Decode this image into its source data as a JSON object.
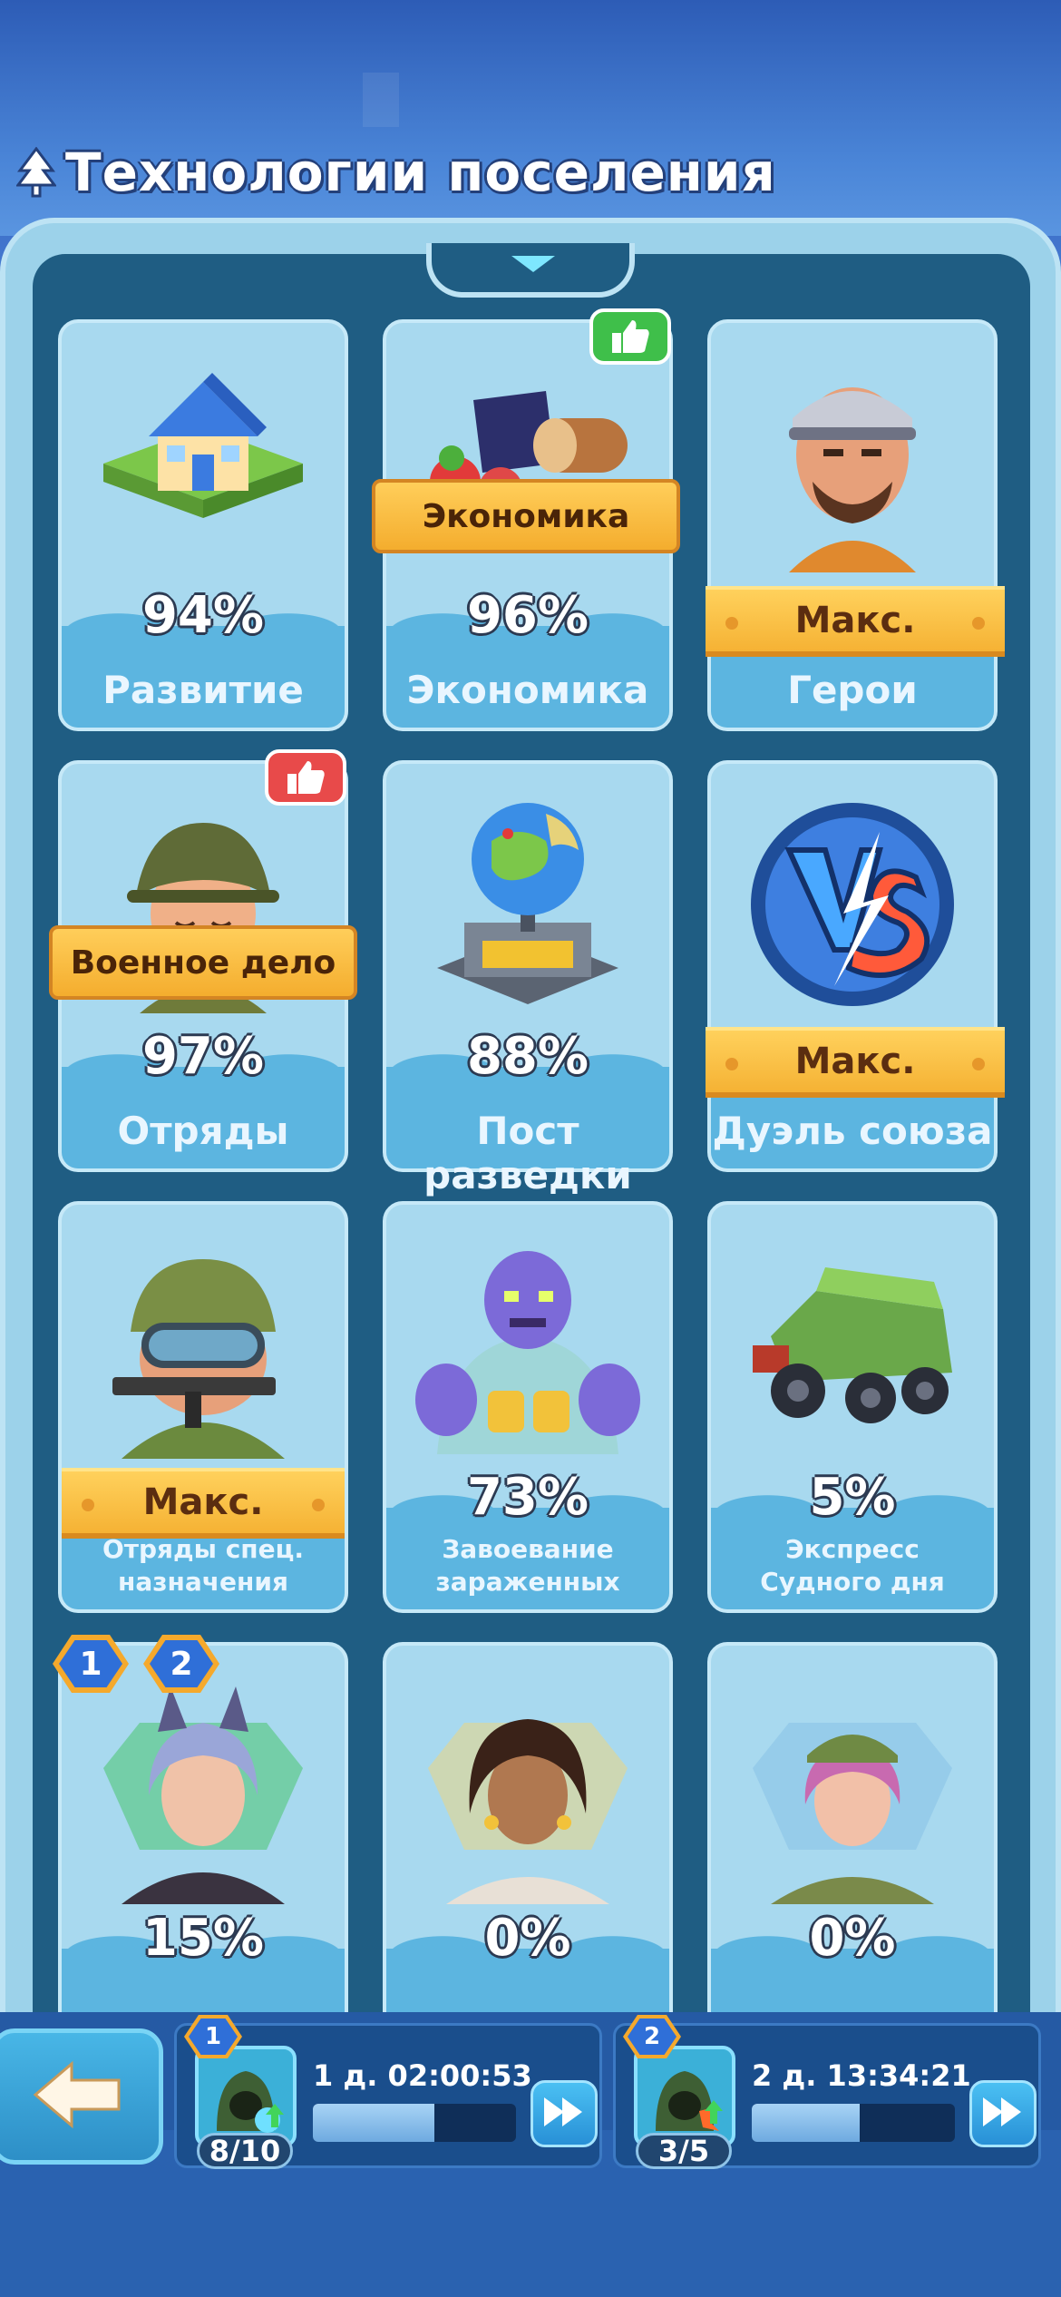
{
  "header": {
    "title": "Технологии поселения",
    "icon": "tree-icon"
  },
  "cards": [
    {
      "name": "Развитие",
      "percent": "94%",
      "art": "house-icon"
    },
    {
      "name": "Экономика",
      "percent": "96%",
      "art": "resources-icon",
      "ribbon": "Экономика",
      "badge": "thumbs-up-green"
    },
    {
      "name": "Герои",
      "percent": "",
      "art": "hero-icon",
      "max": "Макс."
    },
    {
      "name": "Отряды",
      "percent": "97%",
      "art": "soldier-icon",
      "ribbon": "Военное дело",
      "badge": "thumbs-up-red"
    },
    {
      "name": "Пост разведки",
      "percent": "88%",
      "art": "globe-station-icon"
    },
    {
      "name": "Дуэль союза",
      "percent": "",
      "art": "vs-icon",
      "max": "Макс."
    },
    {
      "name": "Отряды спец. назначения",
      "percent": "",
      "art": "special-forces-icon",
      "max": "Макс."
    },
    {
      "name": "Завоевание зараженных",
      "percent": "73%",
      "art": "zombie-icon"
    },
    {
      "name": "Экспресс Судного дня",
      "percent": "5%",
      "art": "truck-icon"
    },
    {
      "name": "",
      "percent": "15%",
      "art": "hero-girl-icon",
      "num_badges": [
        "1",
        "2"
      ]
    },
    {
      "name": "",
      "percent": "0%",
      "art": "hero-woman-icon"
    },
    {
      "name": "",
      "percent": "0%",
      "art": "hero-pink-icon"
    }
  ],
  "bottom": {
    "back_icon": "back-arrow-icon",
    "queues": [
      {
        "index": "1",
        "timer": "1 д. 02:00:53",
        "count": "8/10",
        "progress": 0.6
      },
      {
        "index": "2",
        "timer": "2 д. 13:34:21",
        "count": "3/5",
        "progress": 0.53
      }
    ]
  },
  "colors": {
    "card": "#a8d9ef",
    "panel": "#1f5d83",
    "banner": "#f5b234",
    "accent": "#2f6fd8"
  }
}
